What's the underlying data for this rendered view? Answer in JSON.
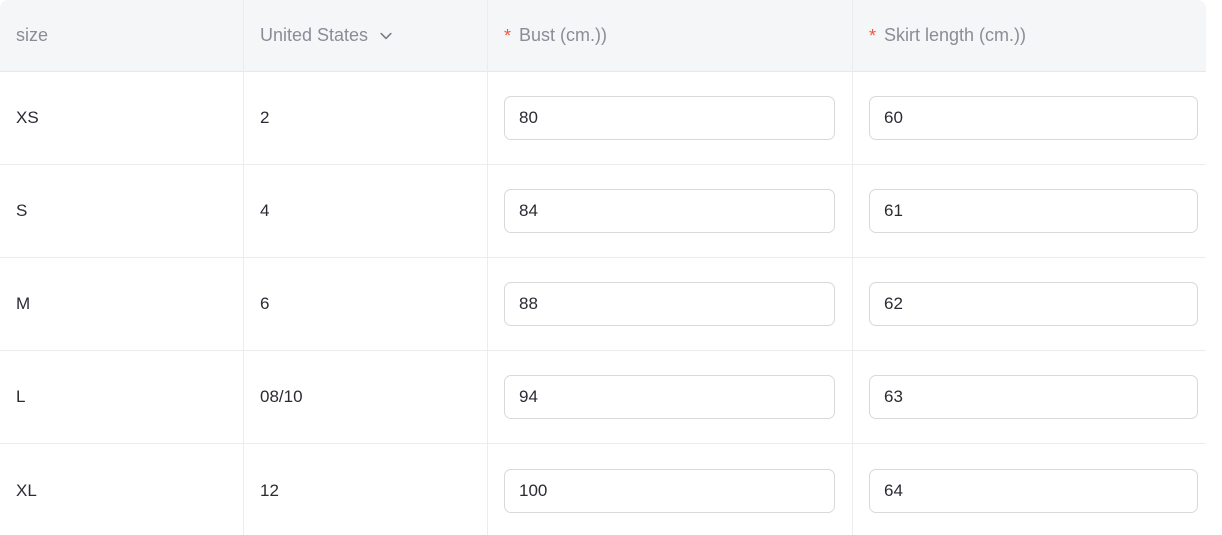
{
  "table": {
    "columns": [
      {
        "key": "size",
        "label": "size",
        "required": false,
        "has_dropdown": false,
        "type": "text"
      },
      {
        "key": "us",
        "label": "United States",
        "required": false,
        "has_dropdown": true,
        "dropdown_icon": "chevron-down-icon",
        "type": "text"
      },
      {
        "key": "bust",
        "label": "Bust (cm.))",
        "required": true,
        "has_dropdown": false,
        "type": "input"
      },
      {
        "key": "skirt",
        "label": "Skirt length (cm.))",
        "required": true,
        "has_dropdown": false,
        "type": "input"
      }
    ],
    "required_marker": "*",
    "rows": [
      {
        "size": "XS",
        "us": "2",
        "bust": "80",
        "skirt": "60"
      },
      {
        "size": "S",
        "us": "4",
        "bust": "84",
        "skirt": "61"
      },
      {
        "size": "M",
        "us": "6",
        "bust": "88",
        "skirt": "62"
      },
      {
        "size": "L",
        "us": "08/10",
        "bust": "94",
        "skirt": "63"
      },
      {
        "size": "XL",
        "us": "12",
        "bust": "100",
        "skirt": "64"
      }
    ]
  },
  "colors": {
    "header_background": "#f5f6f8",
    "header_text": "#8b8c98",
    "required_star": "#f0553a",
    "cell_text": "#2b2b33",
    "border": "#ececec",
    "input_border": "#d9d9da",
    "page_background": "#ffffff"
  }
}
